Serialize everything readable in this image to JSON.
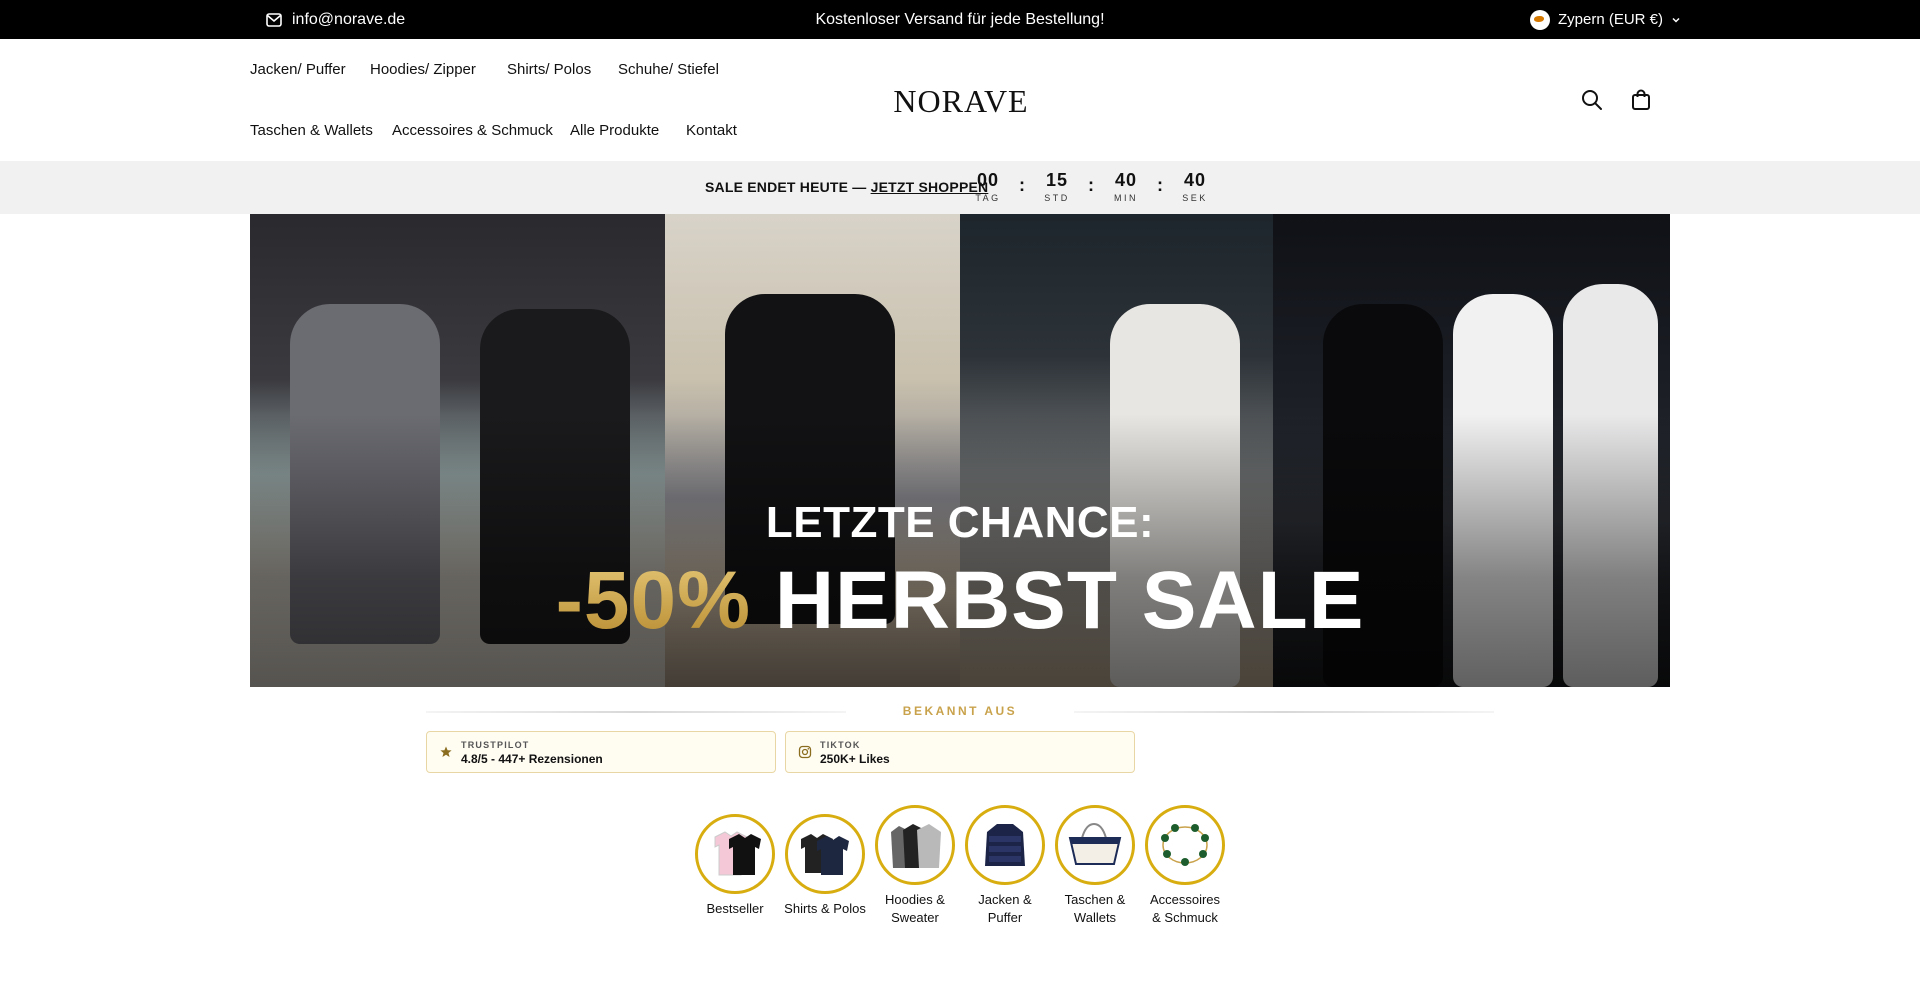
{
  "topbar": {
    "email": "info@norave.de",
    "announcement": "Kostenloser Versand für jede Bestellung!",
    "country": "Zypern (EUR €)"
  },
  "nav": {
    "row1": [
      "Jacken/ Puffer",
      "Hoodies/ Zipper",
      "Shirts/ Polos",
      "Schuhe/ Stiefel"
    ],
    "row2": [
      "Taschen & Wallets",
      "Accessoires & Schmuck",
      "Alle Produkte",
      "Kontakt"
    ]
  },
  "logo": "NORAVE",
  "sale": {
    "text": "SALE ENDET HEUTE — ",
    "link": "JETZT SHOPPEN",
    "countdown": [
      {
        "value": "00",
        "label": "TAG"
      },
      {
        "value": "15",
        "label": "STD"
      },
      {
        "value": "40",
        "label": "MIN"
      },
      {
        "value": "40",
        "label": "SEK"
      }
    ],
    "separator": ":"
  },
  "hero": {
    "kicker": "LETZTE CHANCE:",
    "discount": "-50%",
    "headline": "HERBST SALE"
  },
  "known": {
    "title": "BEKANNT AUS",
    "badges": [
      {
        "label": "TRUSTPILOT",
        "value": "4.8/5 - 447+ Rezensionen",
        "icon": "star-icon"
      },
      {
        "label": "TIKTOK",
        "value": "250K+ Likes",
        "icon": "instagram-icon"
      }
    ]
  },
  "categories": [
    {
      "line1": "Bestseller",
      "line2": ""
    },
    {
      "line1": "Shirts & Polos",
      "line2": ""
    },
    {
      "line1": "Hoodies &",
      "line2": "Sweater"
    },
    {
      "line1": "Jacken &",
      "line2": "Puffer"
    },
    {
      "line1": "Taschen &",
      "line2": "Wallets"
    },
    {
      "line1": "Accessoires",
      "line2": "& Schmuck"
    }
  ],
  "colors": {
    "accent_gold": "#c9a24c",
    "circle_border": "#d7ad10",
    "topbar_bg": "#000000",
    "salebar_bg": "#f1f1f1"
  }
}
